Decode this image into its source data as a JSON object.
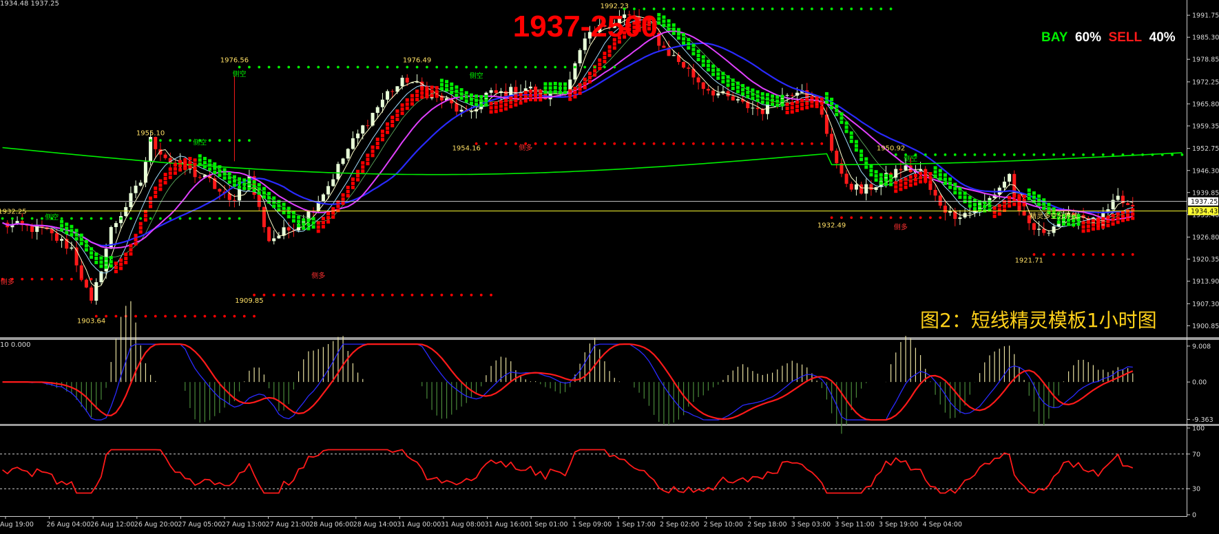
{
  "header": {
    "ohlc_text": "1934.48 1937.25",
    "oscillator_text": "10 0.000"
  },
  "big_price": "1937-2500",
  "sentiment": {
    "buy_label": "BAY",
    "buy_pct": "60%",
    "sell_label": "SELL",
    "sell_pct": "40%",
    "buy_color": "#00ee00",
    "sell_color": "#ff1a1a",
    "pct_color": "#ffffff"
  },
  "caption": "图2：短线精灵模板1小时图",
  "colors": {
    "bull_candle": "#e8ffd8",
    "bear_candle": "#ff1a1a",
    "green": "#00ee00",
    "red": "#ff0000",
    "blue": "#2a2aff",
    "magenta": "#e040ff",
    "yellow_label": "#ffe066",
    "grid_line": "#ffffff",
    "axis_text": "#d8d8d8"
  },
  "chart_data": [
    {
      "type": "candlestick",
      "ylim": [
        1897.5,
        1995.0
      ],
      "price_ticks": [
        "1991.75",
        "1985.30",
        "1978.85",
        "1972.25",
        "1965.80",
        "1959.35",
        "1952.75",
        "1946.30",
        "1939.85",
        "1933.40",
        "1926.80",
        "1920.35",
        "1913.90",
        "1907.30",
        "1900.85"
      ],
      "price_tick_values": [
        1991.75,
        1985.3,
        1978.85,
        1972.25,
        1965.8,
        1959.35,
        1952.75,
        1946.3,
        1939.85,
        1933.4,
        1926.8,
        1920.35,
        1913.9,
        1907.3,
        1900.85
      ],
      "current_price_labels": [
        {
          "text": "1937.25",
          "value": 1937.25,
          "bg": "#ffffff",
          "fg": "#000000"
        },
        {
          "text": "1934.43",
          "value": 1934.43,
          "bg": "#ffff33",
          "fg": "#000000"
        }
      ],
      "horizontal_lines": [
        {
          "value": 1937.25,
          "color": "#c8c8c8"
        },
        {
          "value": 1934.43,
          "color": "#ffff33"
        }
      ],
      "x_labels": [
        "Aug 19:00",
        "26 Aug 04:00",
        "26 Aug 12:00",
        "26 Aug 20:00",
        "27 Aug 05:00",
        "27 Aug 13:00",
        "27 Aug 21:00",
        "28 Aug 06:00",
        "28 Aug 14:00",
        "31 Aug 00:00",
        "31 Aug 08:00",
        "31 Aug 16:00",
        "1 Sep 01:00",
        "1 Sep 09:00",
        "1 Sep 17:00",
        "2 Sep 02:00",
        "2 Sep 10:00",
        "2 Sep 18:00",
        "3 Sep 03:00",
        "3 Sep 11:00",
        "3 Sep 19:00",
        "4 Sep 04:00"
      ],
      "price_key_points": [
        [
          0,
          1930.5
        ],
        [
          8,
          1929.0
        ],
        [
          14,
          1923.5
        ],
        [
          18,
          1907.0
        ],
        [
          22,
          1929.0
        ],
        [
          28,
          1943.0
        ],
        [
          30,
          1955.1
        ],
        [
          34,
          1949.0
        ],
        [
          38,
          1946.0
        ],
        [
          42,
          1943.0
        ],
        [
          46,
          1937.0
        ],
        [
          50,
          1944.0
        ],
        [
          54,
          1926.0
        ],
        [
          58,
          1929.0
        ],
        [
          62,
          1934.0
        ],
        [
          66,
          1942.0
        ],
        [
          70,
          1952.5
        ],
        [
          74,
          1961.0
        ],
        [
          78,
          1969.0
        ],
        [
          82,
          1973.0
        ],
        [
          86,
          1969.0
        ],
        [
          90,
          1966.5
        ],
        [
          94,
          1962.0
        ],
        [
          98,
          1968.5
        ],
        [
          102,
          1969.0
        ],
        [
          106,
          1970.5
        ],
        [
          110,
          1968.0
        ],
        [
          114,
          1970.0
        ],
        [
          118,
          1984.0
        ],
        [
          122,
          1989.0
        ],
        [
          126,
          1991.5
        ],
        [
          130,
          1990.0
        ],
        [
          134,
          1982.0
        ],
        [
          138,
          1977.0
        ],
        [
          142,
          1971.0
        ],
        [
          146,
          1968.0
        ],
        [
          150,
          1965.5
        ],
        [
          154,
          1964.0
        ],
        [
          158,
          1968.0
        ],
        [
          162,
          1971.0
        ],
        [
          166,
          1962.0
        ],
        [
          170,
          1944.0
        ],
        [
          174,
          1940.0
        ],
        [
          178,
          1943.0
        ],
        [
          182,
          1947.0
        ],
        [
          186,
          1946.0
        ],
        [
          188,
          1940.0
        ],
        [
          192,
          1933.5
        ],
        [
          196,
          1934.0
        ],
        [
          200,
          1938.0
        ],
        [
          204,
          1945.0
        ],
        [
          206,
          1933.0
        ],
        [
          210,
          1928.0
        ],
        [
          214,
          1931.0
        ],
        [
          218,
          1933.5
        ],
        [
          222,
          1930.5
        ],
        [
          226,
          1938.0
        ],
        [
          229,
          1934.5
        ]
      ],
      "annotations": [
        {
          "text": "1976.56",
          "bar": 47,
          "value": 1978.0,
          "color": "#ffe066"
        },
        {
          "text": "1976.49",
          "bar": 84,
          "value": 1978.0,
          "color": "#ffe066"
        },
        {
          "text": "1992.23",
          "bar": 124,
          "value": 1993.8,
          "color": "#ffe066"
        },
        {
          "text": "1955.10",
          "bar": 30,
          "value": 1956.6,
          "color": "#ffe066"
        },
        {
          "text": "1954.16",
          "bar": 94,
          "value": 1952.2,
          "color": "#ffe066"
        },
        {
          "text": "1950.92",
          "bar": 180,
          "value": 1952.2,
          "color": "#ffe066"
        },
        {
          "text": "1932.25",
          "bar": 2,
          "value": 1933.7,
          "color": "#ffe066"
        },
        {
          "text": "1932.49",
          "bar": 168,
          "value": 1929.6,
          "color": "#ffe066"
        },
        {
          "text": "1921.71",
          "bar": 208,
          "value": 1919.4,
          "color": "#ffe066"
        },
        {
          "text": "1909.85",
          "bar": 50,
          "value": 1907.6,
          "color": "#ffe066"
        },
        {
          "text": "1903.64",
          "bar": 18,
          "value": 1901.6,
          "color": "#ffe066"
        },
        {
          "text": "侧空",
          "bar": 48,
          "value": 1973.8,
          "color": "#00ee00"
        },
        {
          "text": "侧空",
          "bar": 96,
          "value": 1973.3,
          "color": "#00ee00"
        },
        {
          "text": "侧空",
          "bar": 40,
          "value": 1953.8,
          "color": "#00ee00"
        },
        {
          "text": "侧空",
          "bar": 10,
          "value": 1931.9,
          "color": "#00ee00"
        },
        {
          "text": "侧空",
          "bar": 184,
          "value": 1949.1,
          "color": "#00ee00"
        },
        {
          "text": "侧多",
          "bar": 106,
          "value": 1952.3,
          "color": "#ff3030"
        },
        {
          "text": "侧多",
          "bar": 64,
          "value": 1914.8,
          "color": "#ff3030"
        },
        {
          "text": "侧多",
          "bar": 1,
          "value": 1913.0,
          "color": "#ff3030"
        },
        {
          "text": "侧多",
          "bar": 182,
          "value": 1929.0,
          "color": "#ff3030"
        },
        {
          "text": "精灵多空分界线",
          "bar": 213,
          "value": 1932.2,
          "color": "#ffe066"
        }
      ],
      "dotted_levels": [
        {
          "from_bar": 48,
          "to_bar": 124,
          "value": 1976.56,
          "color": "#00ee00"
        },
        {
          "from_bar": 126,
          "to_bar": 180,
          "value": 1993.6,
          "color": "#00ee00"
        },
        {
          "from_bar": 30,
          "to_bar": 50,
          "value": 1955.1,
          "color": "#00ee00"
        },
        {
          "from_bar": 0,
          "to_bar": 48,
          "value": 1932.25,
          "color": "#00ee00"
        },
        {
          "from_bar": 181,
          "to_bar": 239,
          "value": 1950.92,
          "color": "#00ee00"
        },
        {
          "from_bar": 96,
          "to_bar": 166,
          "value": 1954.16,
          "color": "#ff0000"
        },
        {
          "from_bar": 51,
          "to_bar": 99,
          "value": 1909.85,
          "color": "#ff0000"
        },
        {
          "from_bar": 19,
          "to_bar": 51,
          "value": 1903.64,
          "color": "#ff0000"
        },
        {
          "from_bar": 0,
          "to_bar": 18,
          "value": 1914.5,
          "color": "#ff0000"
        },
        {
          "from_bar": 168,
          "to_bar": 190,
          "value": 1932.49,
          "color": "#ff0000"
        },
        {
          "from_bar": 209,
          "to_bar": 229,
          "value": 1921.71,
          "color": "#ff0000"
        }
      ],
      "dot_gap_bars": 2
    },
    {
      "type": "macd",
      "ylim": [
        -10.5,
        10.2
      ],
      "ticks": [
        "9.008",
        "0.00",
        "-9.363"
      ],
      "tick_values": [
        9.008,
        0.0,
        -9.363
      ]
    },
    {
      "type": "line",
      "ylim": [
        0,
        100
      ],
      "ticks": [
        "100",
        "70",
        "30",
        "0"
      ],
      "tick_values": [
        100,
        70,
        30,
        0
      ],
      "reference_lines": [
        70,
        30
      ]
    }
  ]
}
